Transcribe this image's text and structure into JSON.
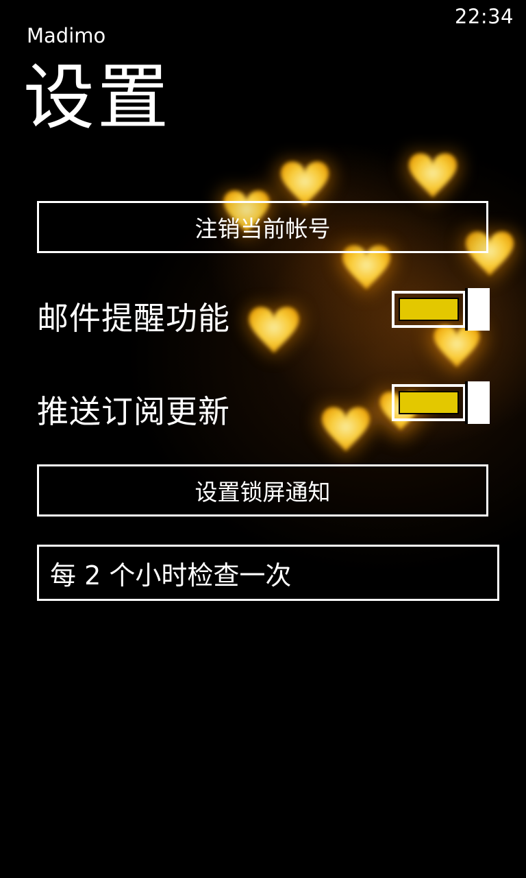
{
  "status_bar": {
    "time": "22:34"
  },
  "header": {
    "app_name": "Madimo",
    "page_title": "设置"
  },
  "settings": {
    "logout_button": "注销当前帐号",
    "mail_reminder": {
      "label": "邮件提醒功能",
      "enabled": true
    },
    "push_updates": {
      "label": "推送订阅更新",
      "enabled": true
    },
    "lockscreen_button": "设置锁屏通知",
    "check_interval": "每 2 个小时检查一次"
  },
  "theme": {
    "accent": "#e3c800",
    "foreground": "#ffffff",
    "background": "#000000"
  }
}
